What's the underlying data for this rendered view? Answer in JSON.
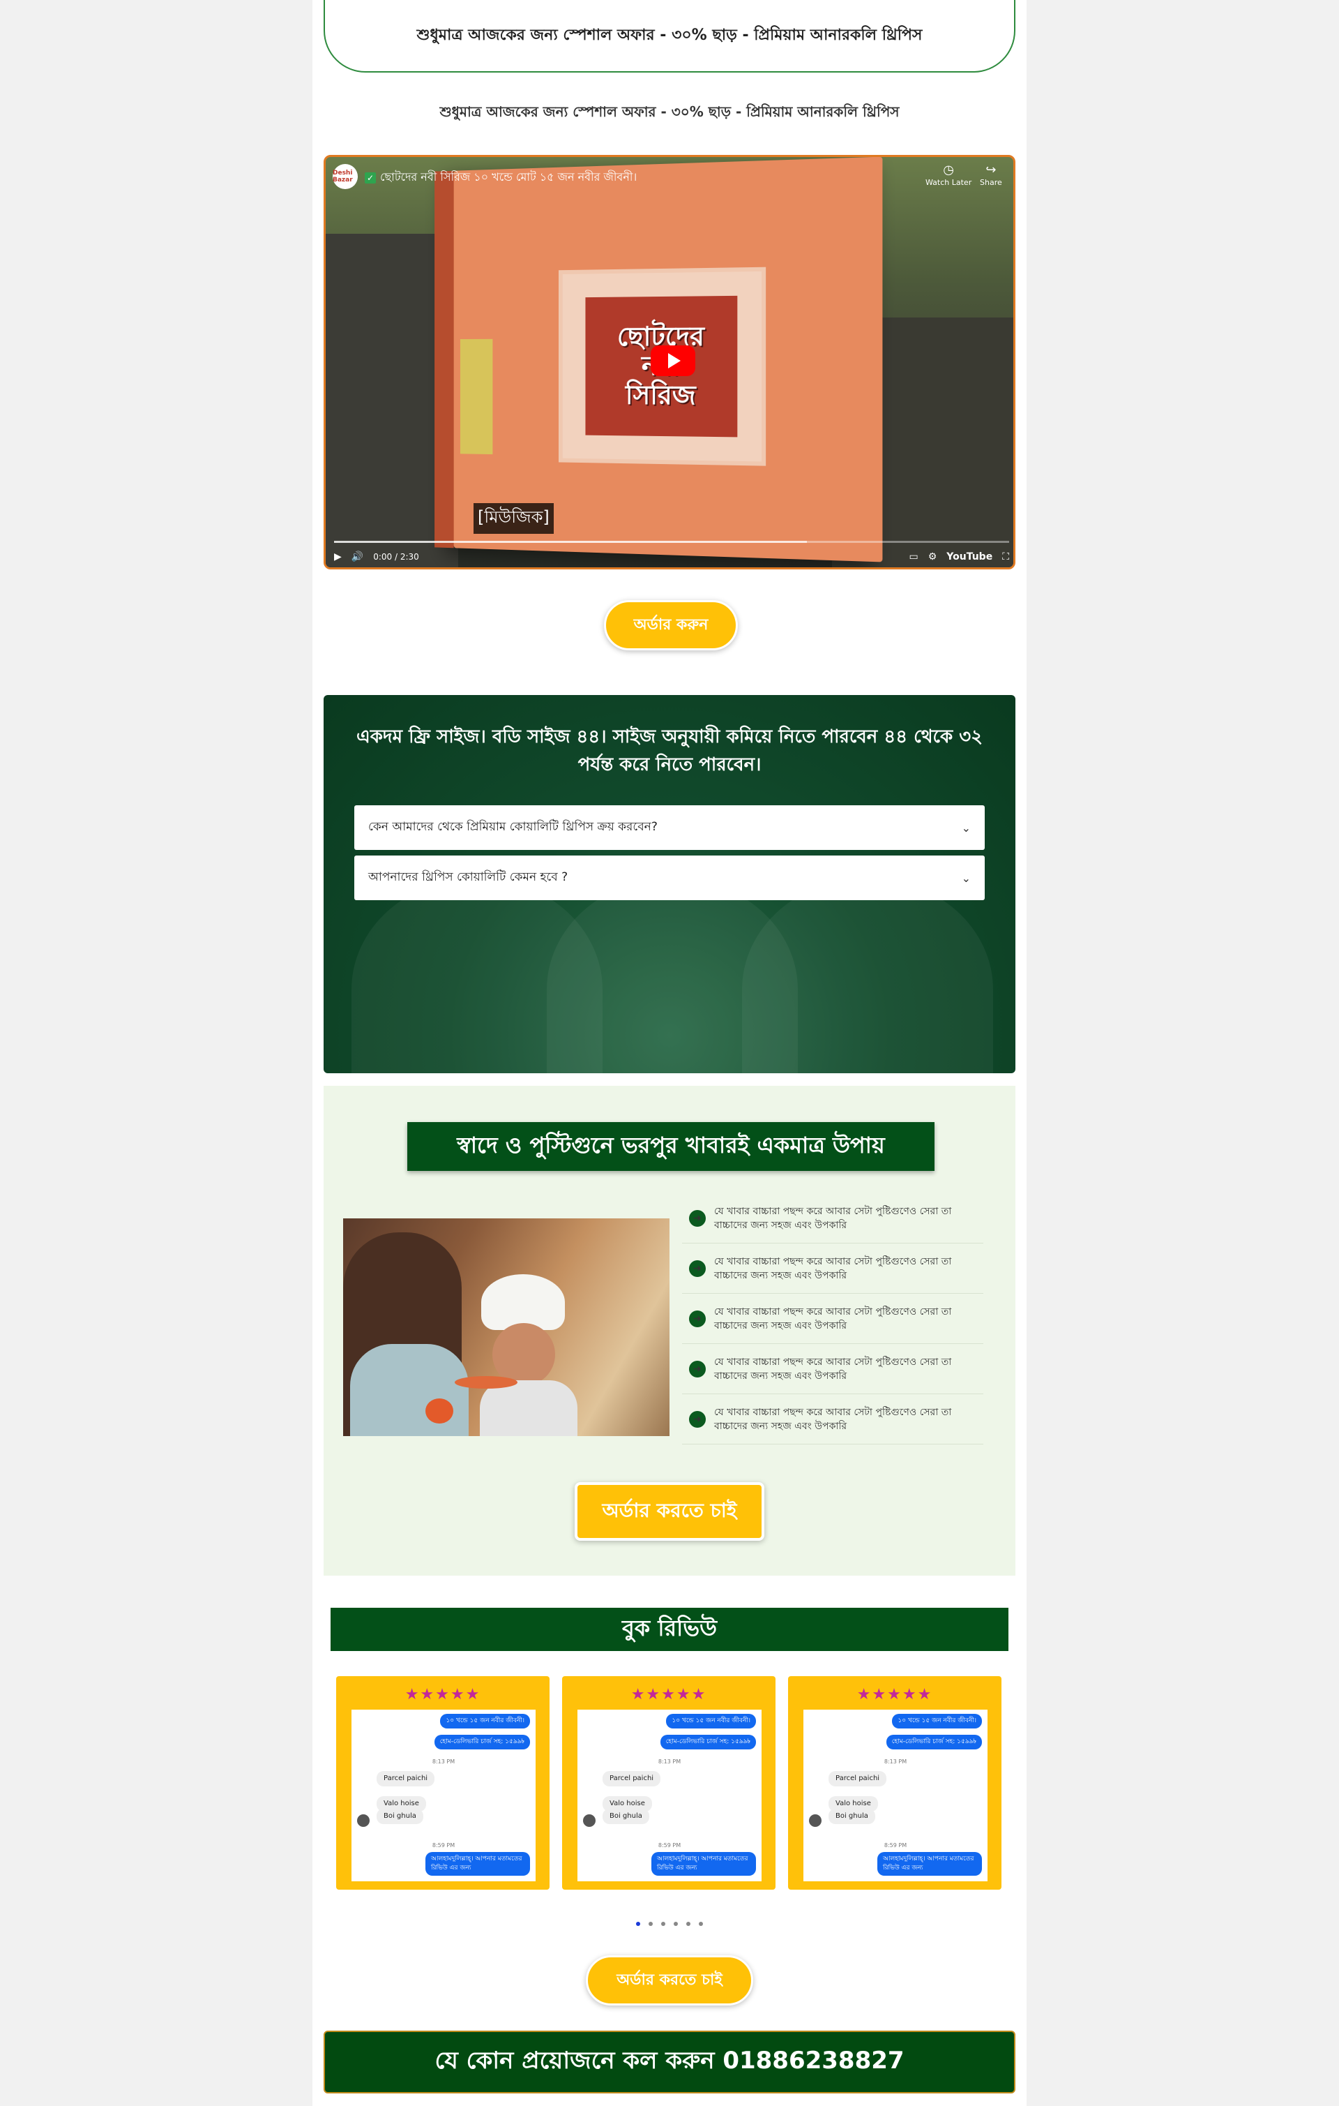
{
  "top_banner": "শুধুমাত্র আজকের জন্য স্পেশাল অফার - ৩০% ছাড় - প্রিমিয়াম আনারকলি থ্রিপিস",
  "sub_headline": "শুধুমাত্র আজকের জন্য স্পেশাল অফার - ৩০% ছাড় - প্রিমিয়াম আনারকলি থ্রিপিস",
  "video": {
    "title": "ছোটদের নবী সিরিজ ১০ খন্ডে মোট ১৫ জন নবীর জীবনী।",
    "channel_logo": "Deshi Bazar",
    "watch_later": "Watch Later",
    "share": "Share",
    "cover_lines": [
      "ছোটদের",
      "নবী",
      "সিরিজ"
    ],
    "caption": "[মিউজিক]",
    "time": "0:00 / 2:30",
    "brand": "YouTube",
    "loaded_fraction": 0.7
  },
  "order_button_1": "অর্ডার করুন",
  "faq": {
    "heading": "একদম ফ্রি সাইজ। বডি সাইজ ৪৪। সাইজ অনুযায়ী কমিয়ে নিতে পারবেন ৪৪ থেকে ৩২ পর্যন্ত করে নিতে পারবেন।",
    "items": [
      "কেন আমাদের থেকে প্রিমিয়াম কোয়ালিটি থ্রিপিস ক্রয় করবেন?",
      "আপনাদের থ্রিপিস কোয়ালিটি কেমন হবে ?"
    ]
  },
  "features": {
    "heading": "স্বাদে ও পুস্টিগুনে ভরপুর খাবারই একমাত্র উপায়",
    "items": [
      "যে খাবার বাচ্চারা পছন্দ করে আবার সেটা পুষ্টিগুণেও সেরা তা বাচ্চাদের জন্য সহজ এবং উপকারি",
      "যে খাবার বাচ্চারা পছন্দ করে আবার সেটা পুষ্টিগুণেও সেরা তা বাচ্চাদের জন্য সহজ এবং উপকারি",
      "যে খাবার বাচ্চারা পছন্দ করে আবার সেটা পুষ্টিগুণেও সেরা তা বাচ্চাদের জন্য সহজ এবং উপকারি",
      "যে খাবার বাচ্চারা পছন্দ করে আবার সেটা পুষ্টিগুণেও সেরা তা বাচ্চাদের জন্য সহজ এবং উপকারি",
      "যে খাবার বাচ্চারা পছন্দ করে আবার সেটা পুষ্টিগুণেও সেরা তা বাচ্চাদের জন্য সহজ এবং উপকারি"
    ],
    "order_button": "অর্ডার করতে চাই"
  },
  "reviews": {
    "heading": "বুক রিভিউ",
    "stars": "★★★★★",
    "chat": {
      "msg1": "১০ খন্ডে ১৫ জন নবীর জীবনী।",
      "msg2": "হোম-ডেলিভারি চার্জ সহ: ১৫৯৯৳",
      "time1": "8:13 PM",
      "reply1": "Parcel paichi",
      "reply2": "Valo hoise",
      "reply3": "Boi ghula",
      "time2": "8:59 PM",
      "msg3": "আলহামদুলিল্লাহ্‌। আপনার মতামতের রিভিউ এর জন্য"
    },
    "dots_total": 6,
    "dots_active": 1
  },
  "order_button_3": "অর্ডার করতে চাই",
  "call_text": "যে কোন প্রয়োজনে কল করুন 01886238827"
}
